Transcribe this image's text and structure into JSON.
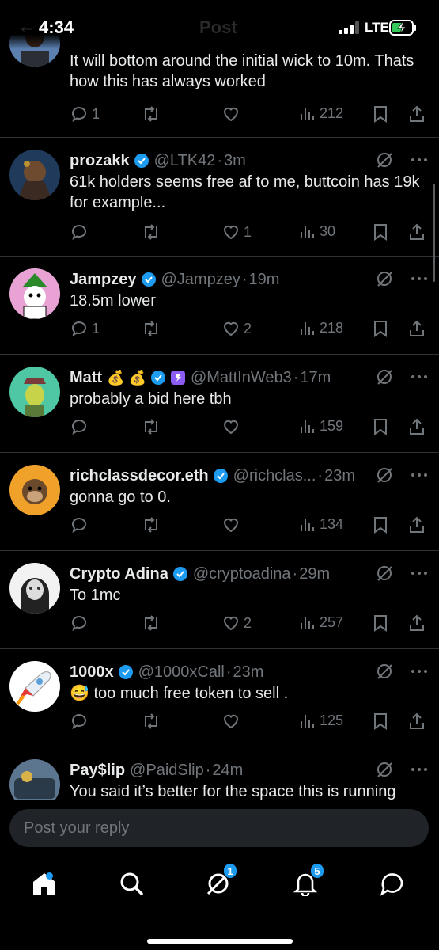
{
  "status_bar": {
    "time": "4:34",
    "network": "LTE",
    "faded_title": "Post"
  },
  "replies": [
    {
      "name": "",
      "handle": "",
      "time": "",
      "verified": false,
      "text": "It will bottom around the initial wick to 10m. Thats how this has always worked",
      "stats": {
        "replies": "1",
        "reposts": "",
        "likes": "",
        "views": "212"
      }
    },
    {
      "name": "prozakk",
      "handle": "@LTK42",
      "time": "3m",
      "verified": true,
      "text": "61k holders seems free af to me, buttcoin has 19k for example...",
      "stats": {
        "replies": "",
        "reposts": "",
        "likes": "1",
        "views": "30"
      }
    },
    {
      "name": "Jampzey",
      "handle": "@Jampzey",
      "time": "19m",
      "verified": true,
      "text": "18.5m lower",
      "stats": {
        "replies": "1",
        "reposts": "",
        "likes": "2",
        "views": "218"
      }
    },
    {
      "name": "Matt",
      "name_emoji": "💰 💰",
      "handle": "@MattInWeb3",
      "time": "17m",
      "verified": true,
      "text": "probably a bid here tbh",
      "stats": {
        "replies": "",
        "reposts": "",
        "likes": "",
        "views": "159"
      }
    },
    {
      "name": "richclassdecor.eth",
      "handle": "@richclas...",
      "time": "23m",
      "verified": true,
      "text": "gonna go to 0.",
      "stats": {
        "replies": "",
        "reposts": "",
        "likes": "",
        "views": "134"
      }
    },
    {
      "name": "Crypto Adina",
      "handle": "@cryptoadina",
      "time": "29m",
      "verified": true,
      "text": "To 1mc",
      "stats": {
        "replies": "",
        "reposts": "",
        "likes": "2",
        "views": "257"
      }
    },
    {
      "name": "1000x",
      "handle": "@1000xCall",
      "time": "23m",
      "verified": true,
      "text": "😅 too much free token to sell .",
      "stats": {
        "replies": "",
        "reposts": "",
        "likes": "",
        "views": "125"
      }
    },
    {
      "name": "Pay$lip",
      "handle": "@PaidSlip",
      "time": "24m",
      "verified": false,
      "text": "You said it’s better for the space this is running",
      "stats": {
        "replies": "",
        "reposts": "",
        "likes": "",
        "views": ""
      }
    }
  ],
  "reply_input": {
    "placeholder": "Post your reply"
  },
  "nav": {
    "items": [
      "home-icon",
      "search-icon",
      "grok-icon",
      "notifications-icon",
      "messages-icon"
    ],
    "grok_badge": "1",
    "notifications_badge": "5"
  },
  "colors": {
    "background": "#000000",
    "accent": "#1d9bf0",
    "muted": "#71767b",
    "text": "#e7e9ea"
  }
}
